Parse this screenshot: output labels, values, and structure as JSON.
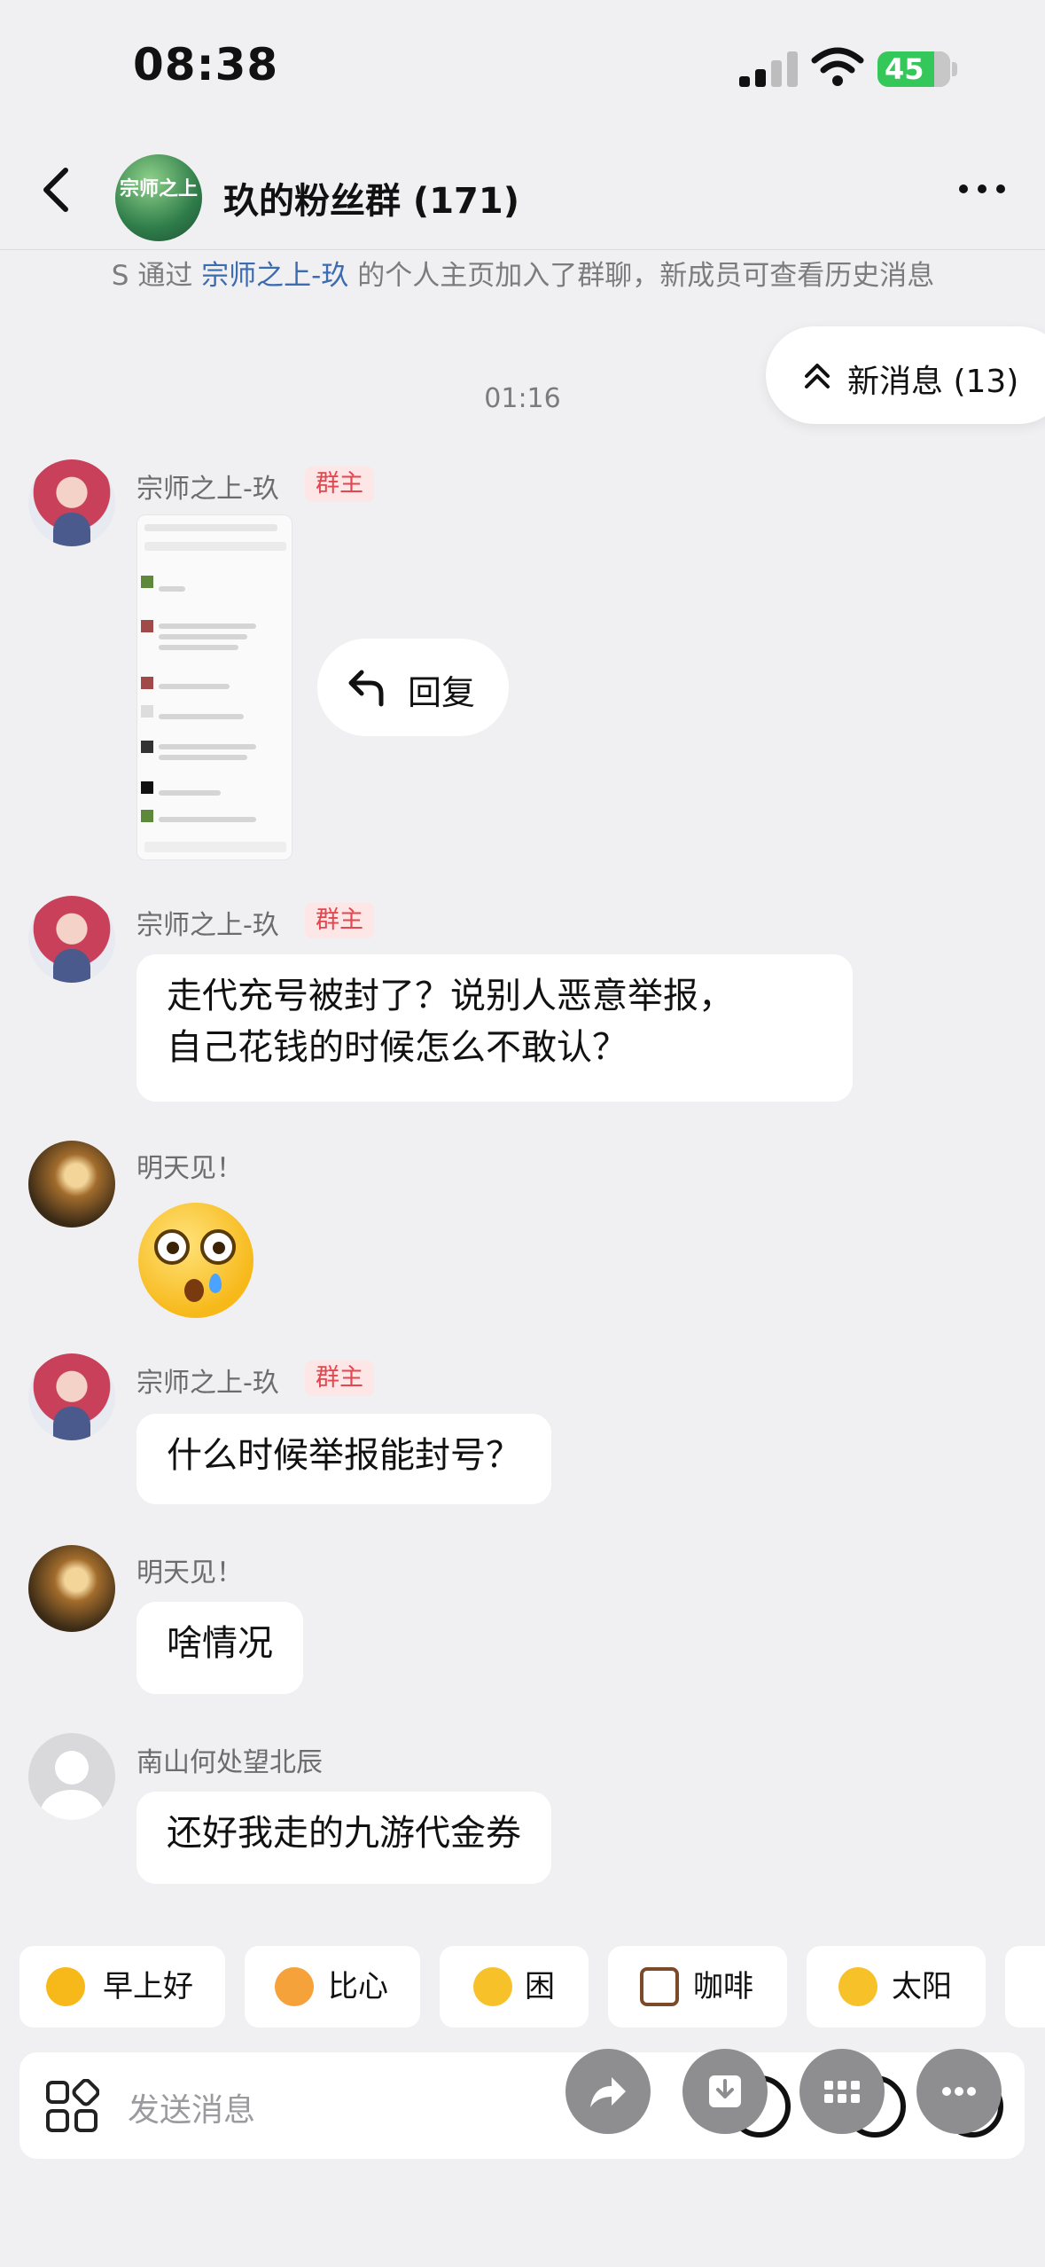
{
  "status_bar": {
    "time": "08:38",
    "battery": "45"
  },
  "header": {
    "group_name": "玖的粉丝群 (171)",
    "avatar_text": "宗师之上"
  },
  "notice": {
    "prefix": "S 通过 ",
    "link": "宗师之上-玖",
    "suffix": " 的个人主页加入了群聊，新成员可查看历史消息"
  },
  "new_messages": {
    "label": "新消息 (13)"
  },
  "timestamp": "01:16",
  "reply_action": {
    "label": "回复"
  },
  "messages": [
    {
      "sender": "宗师之上-玖",
      "badge": "群主",
      "type": "image"
    },
    {
      "sender": "宗师之上-玖",
      "badge": "群主",
      "lines": [
        "走代充号被封了？说别人恶意举报，",
        "自己花钱的时候怎么不敢认？"
      ]
    },
    {
      "sender": "明天见！",
      "type": "emoji"
    },
    {
      "sender": "宗师之上-玖",
      "badge": "群主",
      "text": "什么时候举报能封号？"
    },
    {
      "sender": "明天见！",
      "text": "啥情况"
    },
    {
      "sender": "南山何处望北辰",
      "text": "还好我走的九游代金券"
    }
  ],
  "quick_reactions": [
    {
      "label": "早上好",
      "icon": "sun-face-icon",
      "color": "#f7b91a"
    },
    {
      "label": "比心",
      "icon": "heart-hands-icon",
      "color": "#f6a23a"
    },
    {
      "label": "困",
      "icon": "sleepy-face-icon",
      "color": "#f7c12a"
    },
    {
      "label": "咖啡",
      "icon": "coffee-icon",
      "color": "#7a4a2a"
    },
    {
      "label": "太阳",
      "icon": "sun-icon",
      "color": "#f7c12a"
    }
  ],
  "input": {
    "placeholder": "发送消息"
  },
  "colors": {
    "background": "#f0f0f2",
    "badge_text": "#e2464e",
    "badge_bg": "#fde6e6",
    "link": "#3b6bb0",
    "battery": "#34c759"
  }
}
